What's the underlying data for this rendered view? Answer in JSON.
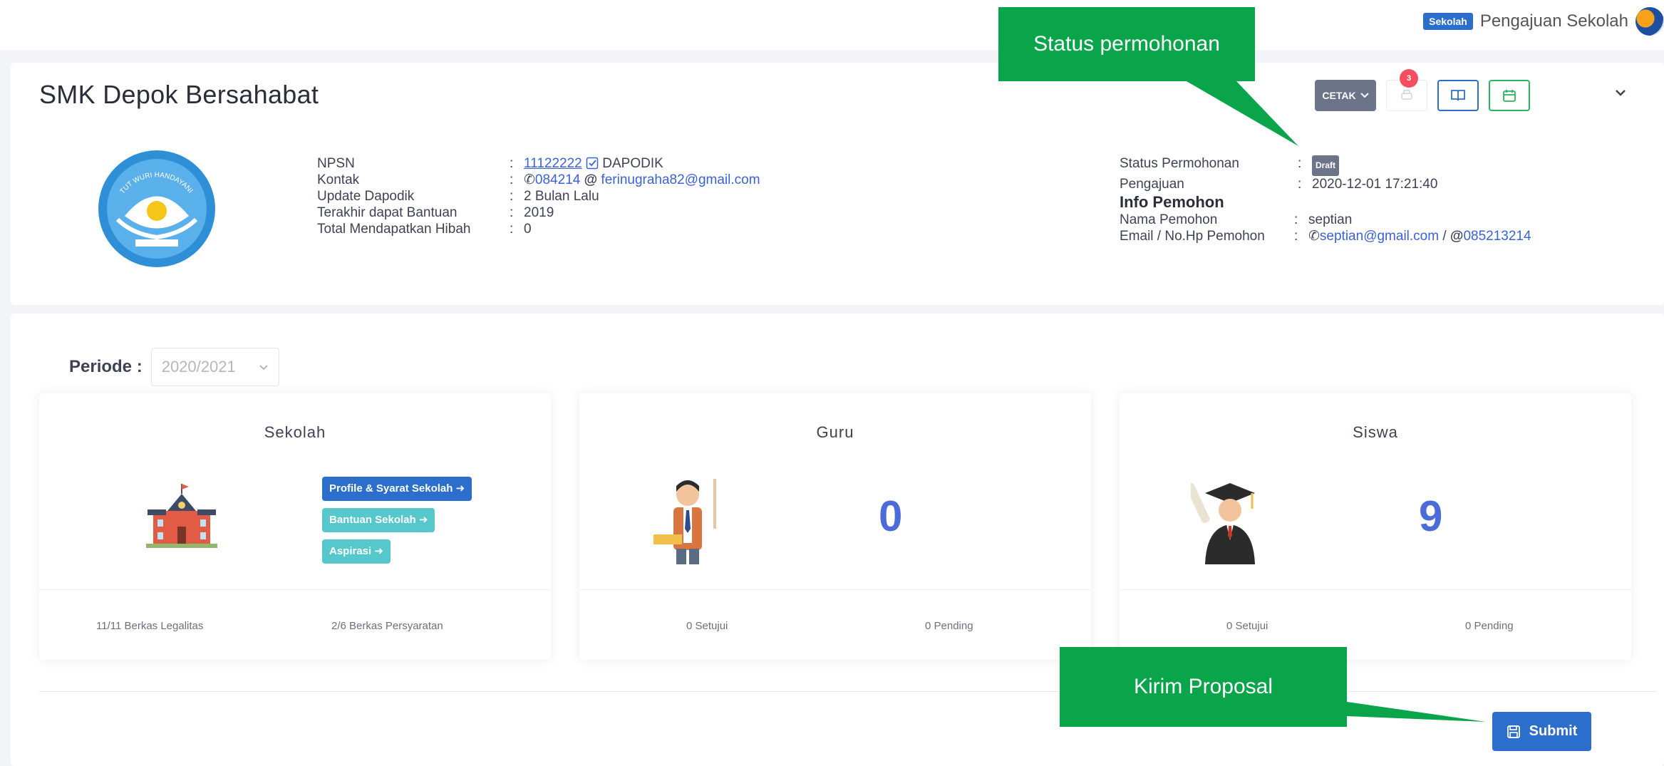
{
  "header": {
    "role_badge": "Sekolah",
    "user_name": "Pengajuan Sekolah"
  },
  "school": {
    "name": "SMK Depok Bersahabat",
    "logo_text": "TUT WURI HANDAYANI",
    "info": {
      "npsn_label": "NPSN",
      "npsn_sep": ":",
      "npsn_value": "11122222",
      "npsn_source": "DAPODIK",
      "kontak_label": "Kontak",
      "kontak_sep": ":",
      "kontak_phone": "084214",
      "kontak_at": "@",
      "kontak_email": "ferinugraha82@gmail.com",
      "update_label": "Update Dapodik",
      "update_sep": ":",
      "update_value": "2 Bulan Lalu",
      "bantuan_label": "Terakhir dapat Bantuan",
      "bantuan_sep": ":",
      "bantuan_value": "2019",
      "hibah_label": "Total Mendapatkan Hibah",
      "hibah_sep": ":",
      "hibah_value": "0"
    },
    "status": {
      "status_label": "Status Permohonan",
      "status_sep": ":",
      "status_value": "Draft",
      "pengajuan_label": "Pengajuan",
      "pengajuan_sep": ":",
      "pengajuan_value": "2020-12-01 17:21:40",
      "pemohon_heading": "Info Pemohon",
      "nama_label": "Nama Pemohon",
      "nama_sep": ":",
      "nama_value": "septian",
      "kontak_label": "Email / No.Hp Pemohon",
      "kontak_sep": ":",
      "email_value": "septian@gmail.com",
      "slash": "/",
      "at": "@",
      "phone_value": "085213214"
    }
  },
  "toolbar": {
    "cetak_label": "CETAK",
    "notif_count": "3"
  },
  "periode": {
    "label": "Periode :",
    "value": "2020/2021"
  },
  "cards": {
    "sekolah": {
      "title": "Sekolah",
      "btn_profile": "Profile & Syarat Sekolah",
      "btn_bantuan": "Bantuan Sekolah",
      "btn_aspirasi": "Aspirasi",
      "foot_left": "11/11 Berkas Legalitas",
      "foot_right": "2/6 Berkas Persyaratan"
    },
    "guru": {
      "title": "Guru",
      "count": "0",
      "foot_left": "0 Setujui",
      "foot_right": "0 Pending"
    },
    "siswa": {
      "title": "Siswa",
      "count": "9",
      "foot_left": "0 Setujui",
      "foot_right": "0 Pending"
    }
  },
  "submit_label": "Submit",
  "callouts": {
    "status": "Status permohonan",
    "kirim": "Kirim Proposal"
  },
  "colors": {
    "primary": "#2c6ecb",
    "info": "#56c8cc",
    "callout_green": "#0aa54a",
    "number": "#4a6bd8",
    "badge_gray": "#6b7489"
  },
  "icons": [
    "phone-icon",
    "check-square-icon",
    "chevron-down-icon",
    "printer-icon",
    "book-icon",
    "calendar-icon",
    "arrow-circle-right-icon",
    "save-icon"
  ]
}
